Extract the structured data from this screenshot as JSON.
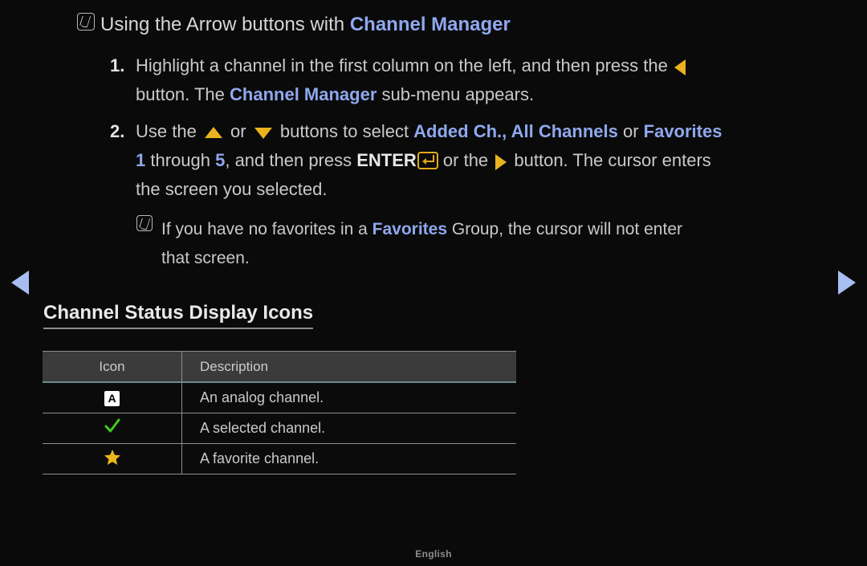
{
  "page": {
    "background_color": "#0a0a0a",
    "accent_blue": "#8fa8ee",
    "accent_amber": "#e9b21e",
    "nav_arrow_color": "#a8bdf2"
  },
  "section_heading": {
    "icon": "note-icon",
    "text_before": "Using the Arrow buttons with ",
    "highlight": "Channel Manager"
  },
  "steps": [
    {
      "number": "1.",
      "line1_a": "Highlight a channel in the first column on the left, and then press the ",
      "arrow": "left-arrow-icon",
      "line2_a": "button. The ",
      "line2_highlight": "Channel Manager",
      "line2_b": " sub-menu appears."
    },
    {
      "number": "2.",
      "line1_a": "Use the ",
      "arrow_up": "up-arrow-icon",
      "line1_b": " or ",
      "arrow_down": "down-arrow-icon",
      "line1_c": " buttons to select ",
      "opt1": "Added Ch.",
      "sep1": ", ",
      "opt2": "All Channels",
      "sep2": " or ",
      "opt3": "Favorites",
      "line2_num1": "1",
      "line2_a": " through ",
      "line2_num2": "5",
      "line2_b": ", and then press ",
      "enter_label": "ENTER",
      "enter_key": "enter-key-icon",
      "line2_c": " or the ",
      "arrow_right": "right-arrow-icon",
      "line2_d": " button. The cursor enters",
      "line3": "the screen you selected."
    }
  ],
  "subnote": {
    "icon": "note-icon",
    "text_a": "If you have no favorites in a ",
    "highlight": "Favorites",
    "text_b": " Group, the cursor will not enter",
    "text_c": "that screen."
  },
  "nav": {
    "prev": "prev-page-arrow",
    "next": "next-page-arrow"
  },
  "table_section": {
    "title": "Channel Status Display Icons",
    "columns": [
      "Icon",
      "Description"
    ],
    "rows": [
      {
        "icon": "analog-channel-icon",
        "icon_label": "A",
        "description": "An analog channel."
      },
      {
        "icon": "selected-channel-check-icon",
        "icon_label": "",
        "description": "A selected channel."
      },
      {
        "icon": "favorite-channel-star-icon",
        "icon_label": "",
        "description": "A favorite channel."
      }
    ]
  },
  "footer": {
    "language": "English"
  }
}
